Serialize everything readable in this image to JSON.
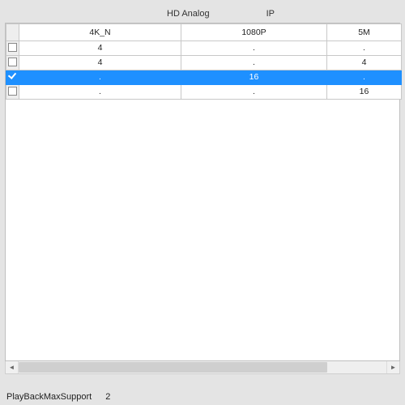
{
  "tabs": {
    "analog": "HD Analog",
    "ip": "IP"
  },
  "columns": {
    "c0": "",
    "c1": "4K_N",
    "c2": "1080P",
    "c3": "5M"
  },
  "rows": [
    {
      "checked": false,
      "selected": false,
      "c1": "4",
      "c2": ".",
      "c3": "."
    },
    {
      "checked": false,
      "selected": false,
      "c1": "4",
      "c2": ".",
      "c3": "4"
    },
    {
      "checked": true,
      "selected": true,
      "c1": ".",
      "c2": "16",
      "c3": "."
    },
    {
      "checked": false,
      "selected": false,
      "c1": ".",
      "c2": ".",
      "c3": "16"
    }
  ],
  "status": {
    "label": "PlayBackMaxSupport",
    "value": "2"
  }
}
